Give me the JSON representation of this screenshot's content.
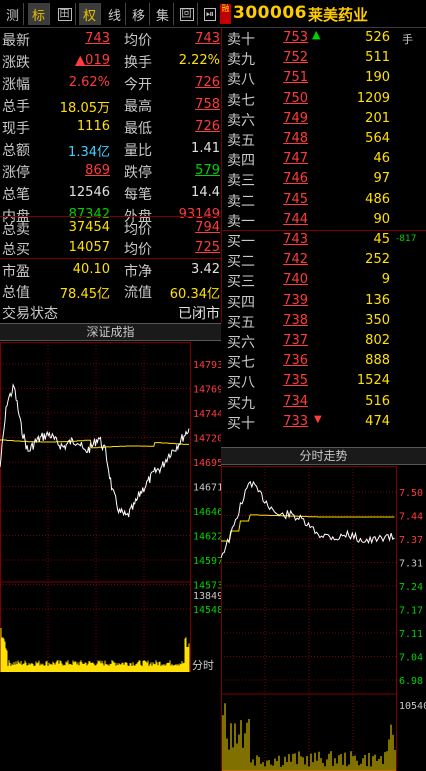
{
  "toolbar": {
    "buttons": [
      "测",
      "标",
      "田",
      "权",
      "线",
      "移",
      "集",
      "回",
      "⏯"
    ],
    "tag": "融",
    "code": "300006",
    "name": "莱美药业",
    "extra": "手"
  },
  "quote": {
    "r1": {
      "l1": "最新",
      "v1": "743",
      "l2": "均价",
      "v2": "743"
    },
    "r2": {
      "l1": "涨跌",
      "v1": "▲019",
      "l2": "换手",
      "v2": "2.22%"
    },
    "r3": {
      "l1": "涨幅",
      "v1": "2.62%",
      "l2": "今开",
      "v2": "726"
    },
    "r4": {
      "l1": "总手",
      "v1": "18.05万",
      "l2": "最高",
      "v2": "758"
    },
    "r5": {
      "l1": "现手",
      "v1": "1116",
      "l2": "最低",
      "v2": "726"
    },
    "r6": {
      "l1": "总额",
      "v1": "1.34亿",
      "l2": "量比",
      "v2": "1.41"
    },
    "r7": {
      "l1": "涨停",
      "v1": "869",
      "l2": "跌停",
      "v2": "579"
    },
    "r8": {
      "l1": "总笔",
      "v1": "12546",
      "l2": "每笔",
      "v2": "14.4"
    },
    "r9": {
      "l1": "内盘",
      "v1": "87342",
      "l2": "外盘",
      "v2": "93149"
    },
    "r10": {
      "l1": "总卖",
      "v1": "37454",
      "l2": "均价",
      "v2": "794"
    },
    "r11": {
      "l1": "总买",
      "v1": "14057",
      "l2": "均价",
      "v2": "725"
    },
    "r12": {
      "l1": "市盈",
      "v1": "40.10",
      "l2": "市净",
      "v2": "3.42"
    },
    "r13": {
      "l1": "总值",
      "v1": "78.45亿",
      "l2": "流值",
      "v2": "60.34亿"
    },
    "r14": {
      "l1": "交易状态",
      "v2": "已闭市"
    }
  },
  "orderbook": {
    "sell": [
      {
        "label": "卖十",
        "price": "753",
        "vol": "526"
      },
      {
        "label": "卖九",
        "price": "752",
        "vol": "511"
      },
      {
        "label": "卖八",
        "price": "751",
        "vol": "190"
      },
      {
        "label": "卖七",
        "price": "750",
        "vol": "1209"
      },
      {
        "label": "卖六",
        "price": "749",
        "vol": "201"
      },
      {
        "label": "卖五",
        "price": "748",
        "vol": "564"
      },
      {
        "label": "卖四",
        "price": "747",
        "vol": "46"
      },
      {
        "label": "卖三",
        "price": "746",
        "vol": "97"
      },
      {
        "label": "卖二",
        "price": "745",
        "vol": "486"
      },
      {
        "label": "卖一",
        "price": "744",
        "vol": "90"
      }
    ],
    "buy": [
      {
        "label": "买一",
        "price": "743",
        "vol": "45",
        "extra": "-817"
      },
      {
        "label": "买二",
        "price": "742",
        "vol": "252"
      },
      {
        "label": "买三",
        "price": "740",
        "vol": "9"
      },
      {
        "label": "买四",
        "price": "739",
        "vol": "136"
      },
      {
        "label": "买五",
        "price": "738",
        "vol": "350"
      },
      {
        "label": "买六",
        "price": "737",
        "vol": "802"
      },
      {
        "label": "买七",
        "price": "736",
        "vol": "888"
      },
      {
        "label": "买八",
        "price": "735",
        "vol": "1524"
      },
      {
        "label": "买九",
        "price": "734",
        "vol": "516"
      },
      {
        "label": "买十",
        "price": "733",
        "vol": "474"
      }
    ]
  },
  "index_chart": {
    "title": "深证成指",
    "ticks": [
      "14793",
      "14769",
      "14744",
      "14720",
      "14695",
      "14671",
      "14646",
      "14622",
      "14597",
      "14573",
      "14548"
    ],
    "vol_max": "13849",
    "time_label": "分时"
  },
  "stock_chart": {
    "title": "分时走势",
    "ticks": [
      "7.50",
      "7.44",
      "7.37",
      "7.31",
      "7.24",
      "7.17",
      "7.11",
      "7.04",
      "6.98"
    ],
    "vol_max": "10540"
  },
  "colors": {
    "up": "#ff3b3b",
    "down": "#00d200",
    "price_line": "#ffffff",
    "avg_line": "#ffe000",
    "grid": "#7a0000",
    "volume": "#ffe000"
  }
}
